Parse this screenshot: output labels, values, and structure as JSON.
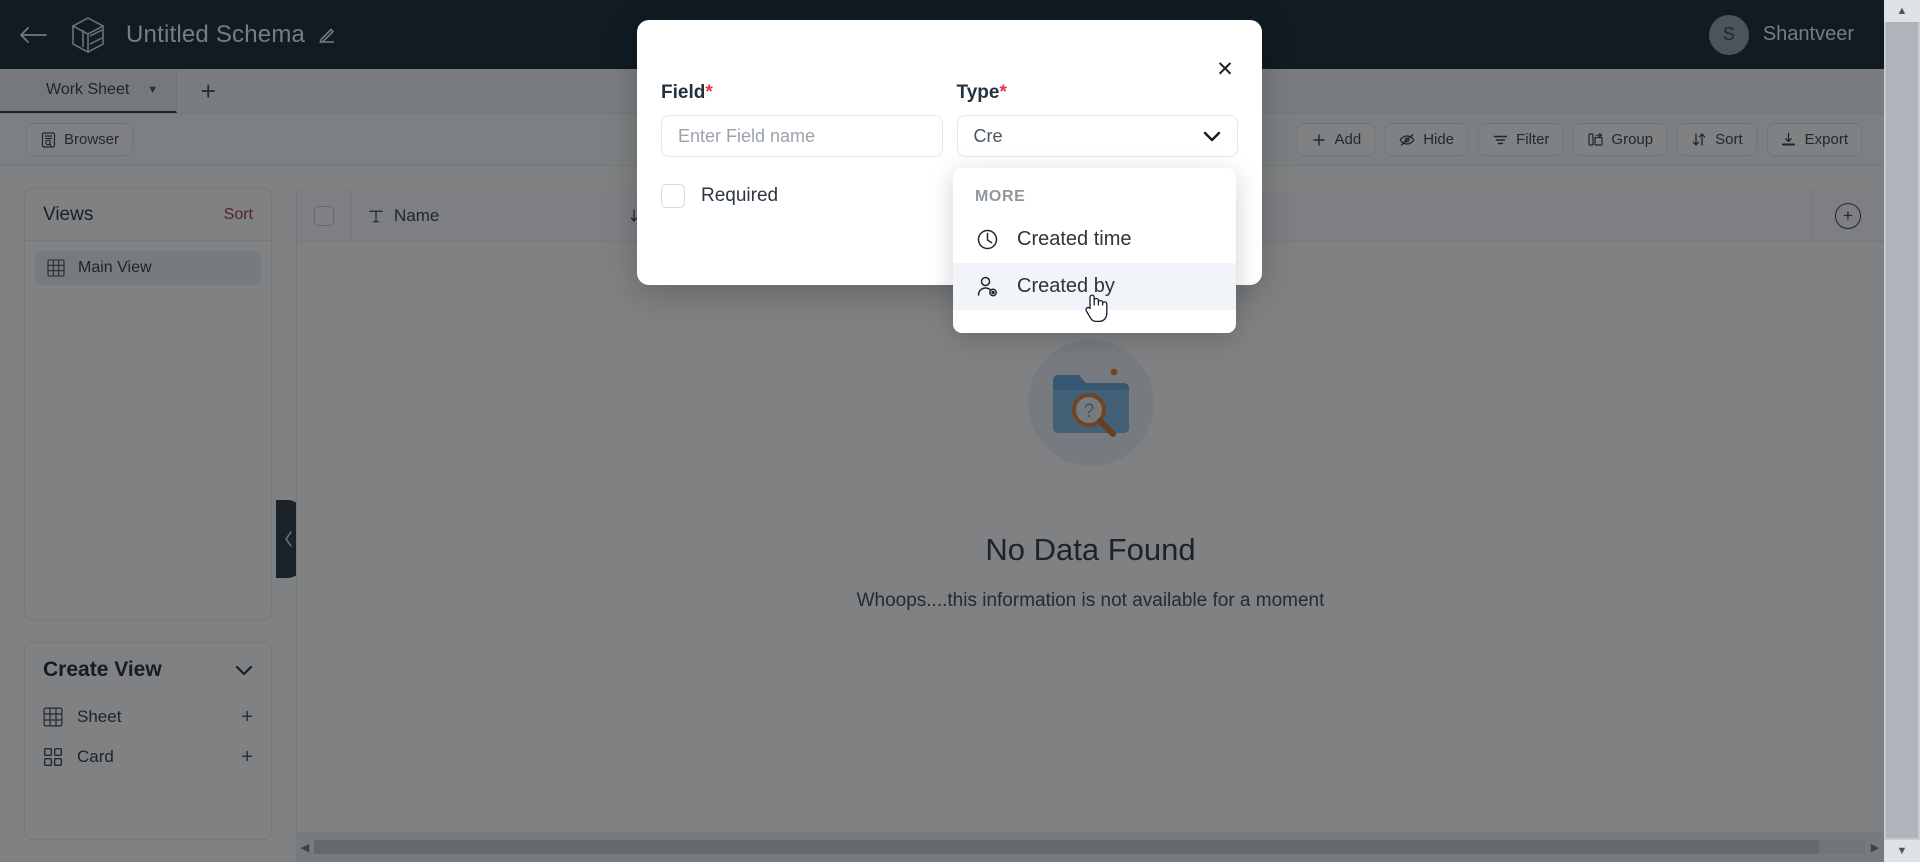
{
  "topbar": {
    "back_icon": "arrow-left-icon",
    "logo_icon": "cube-logo-icon",
    "title": "Untitled Schema",
    "edit_icon": "pencil-icon",
    "user": {
      "initial": "S",
      "name": "Shantveer"
    }
  },
  "tabs": {
    "items": [
      {
        "icon": "table-icon",
        "label": "Work Sheet",
        "chevron": "chevron-down-icon"
      }
    ],
    "add_label": "+"
  },
  "toolbar": {
    "browser": {
      "icon": "browser-icon",
      "label": "Browser"
    },
    "actions": [
      {
        "icon": "plus-icon",
        "label": "Add"
      },
      {
        "icon": "eye-off-icon",
        "label": "Hide"
      },
      {
        "icon": "filter-icon",
        "label": "Filter"
      },
      {
        "icon": "group-icon",
        "label": "Group"
      },
      {
        "icon": "sort-icon",
        "label": "Sort"
      },
      {
        "icon": "export-icon",
        "label": "Export"
      }
    ]
  },
  "views_panel": {
    "title": "Views",
    "sort_label": "Sort",
    "items": [
      {
        "icon": "grid-icon",
        "label": "Main View"
      }
    ]
  },
  "create_view_panel": {
    "title": "Create View",
    "chevron": "chevron-down-icon",
    "items": [
      {
        "icon": "grid-icon",
        "label": "Sheet",
        "action": "+"
      },
      {
        "icon": "card-icon",
        "label": "Card",
        "action": "+"
      }
    ]
  },
  "collapse_handle": {
    "icon": "chevron-left-icon"
  },
  "grid": {
    "columns": [
      {
        "type_icon": "text-type-icon",
        "label": "Name",
        "sort_icon": "sort-icon",
        "menu_icon": "chevron-down-icon"
      }
    ],
    "add_column_icon": "plus-circle-icon",
    "empty": {
      "illustration": "folder-search-icon",
      "title": "No Data Found",
      "subtitle": "Whoops....this information is not available for a moment"
    }
  },
  "scrollbars": {
    "horizontal": {
      "left_arrow": "◀",
      "right_arrow": "▶"
    },
    "vertical": {
      "up_arrow": "▲",
      "down_arrow": "▼"
    }
  },
  "modal": {
    "close_icon": "close-icon",
    "field": {
      "label": "Field",
      "required_mark": "*",
      "placeholder": "Enter Field name",
      "value": ""
    },
    "type": {
      "label": "Type",
      "required_mark": "*",
      "value": "Cre",
      "chevron": "chevron-down-icon"
    },
    "required_checkbox": {
      "label": "Required",
      "checked": false
    },
    "secondary_toggle": {
      "name": "unique-toggle",
      "checked": false
    }
  },
  "dropdown": {
    "group_label": "MORE",
    "items": [
      {
        "icon": "clock-icon",
        "label": "Created time",
        "active": false
      },
      {
        "icon": "user-check-icon",
        "label": "Created by",
        "active": true
      }
    ]
  },
  "cursor": {
    "icon": "pointer-hand-cursor"
  },
  "colors": {
    "topbar_bg": "#0b2028",
    "accent_red": "#e2394f",
    "sort_link": "#9d2f4a",
    "scrim": "rgba(22,26,29,0.55)"
  }
}
